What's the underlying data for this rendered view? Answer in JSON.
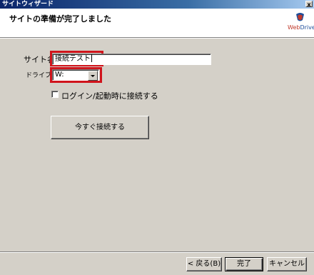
{
  "window": {
    "title": "サイトウィザード",
    "close_glyph": "x"
  },
  "header": {
    "page_title": "サイトの準備が完了しました",
    "logo": {
      "text_web": "Web",
      "text_drive": "Drive",
      "colors": [
        "#c0392b",
        "#1f4e9a"
      ]
    }
  },
  "form": {
    "site_name_label": "サイト名:",
    "site_name_value": "接続テスト",
    "drive_label": "ドライブ:",
    "drive_value": "W:",
    "login_checkbox_label": "ログイン/起動時に接続する",
    "login_checkbox_checked": false,
    "connect_now_button": "今すぐ接続する"
  },
  "footer": {
    "back_button": "< 戻る(B)",
    "finish_button": "完了",
    "cancel_button": "キャンセル"
  },
  "colors": {
    "highlight": "#d0141c",
    "titlebar": "#0a246a",
    "dialog_bg": "#d4d0c8"
  }
}
